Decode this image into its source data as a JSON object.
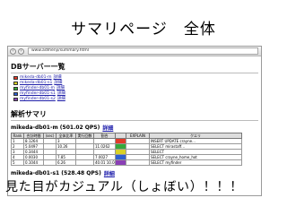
{
  "slide_title": "サマリページ　全体",
  "browser": {
    "back_icon": "back-arrow-icon",
    "forward_icon": "forward-arrow-icon",
    "url": "www.admenji/summary.html"
  },
  "db_section": {
    "heading": "DBサーバー一覧",
    "servers": [
      {
        "name": "mikeda-db01-m",
        "link": "詳細",
        "color": "#e23b2a"
      },
      {
        "name": "mikeda-db01-s1",
        "link": "詳細",
        "color": "#d9d226"
      },
      {
        "name": "myfinder-db01-m",
        "link": "詳細",
        "color": "#36a83a"
      },
      {
        "name": "myfinder-db01-s1",
        "link": "詳細",
        "color": "#2f5fd0"
      },
      {
        "name": "myfinder-db01-s2",
        "link": "詳細",
        "color": "#8a3fb6"
      }
    ]
  },
  "summary": {
    "heading": "解析サマリ",
    "hosts": [
      {
        "title": "mikeda-db01-m (501.02 QPS)",
        "link": "詳細",
        "columns": [
          "Rank",
          "合計時間",
          "(sec)",
          "全体比率",
          "実行回数",
          "割合",
          "",
          "EXPLAIN",
          "クエリ"
        ],
        "rows": [
          [
            "1",
            "8.1264",
            "",
            "3",
            "",
            "",
            "#e23b2a",
            "",
            "INSERT UPDATE crayne..."
          ],
          [
            "2",
            "5.0497",
            "",
            "10.26",
            "",
            "11.0262",
            "#36a83a",
            "",
            "SELECT mirastaff..."
          ],
          [
            "3",
            "0.3444",
            "",
            "",
            "",
            "",
            "#d9d226",
            "",
            "SELECT"
          ],
          [
            "4",
            "0.0030",
            "",
            "7.85",
            "",
            "7.0027",
            "#2f5fd0",
            "",
            "SELECT crayne_home_hot"
          ],
          [
            "5",
            "0.1044",
            "",
            "6.26",
            "",
            "40.01 10.0000",
            "#8a3fb6",
            "",
            "SELECT myfinder"
          ]
        ]
      },
      {
        "title": "mikeda-db01-s1 (528.48 QPS)",
        "link": "詳細"
      }
    ]
  },
  "bottom_caption": "見た目がカジュアル（しょぼい）！！！"
}
